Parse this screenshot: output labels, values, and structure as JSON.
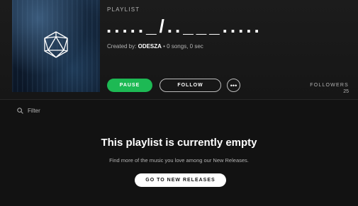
{
  "header": {
    "type_label": "PLAYLIST",
    "title": "....._/..___.....",
    "created_by_label": "Created by:",
    "owner": "ODESZA",
    "stats": " • 0 songs, 0 sec"
  },
  "cover": {
    "icon": "icosahedron-logo-icon"
  },
  "actions": {
    "pause_label": "PAUSE",
    "follow_label": "FOLLOW",
    "more_label": "•••"
  },
  "followers": {
    "label": "FOLLOWERS",
    "count": "25"
  },
  "filter": {
    "icon": "search-icon",
    "placeholder": "Filter"
  },
  "empty_state": {
    "title": "This playlist is currently empty",
    "subtitle": "Find more of the music you love among our New Releases.",
    "button_label": "GO TO NEW RELEASES"
  },
  "colors": {
    "accent": "#1db954",
    "background": "#121212",
    "text_secondary": "#b3b3b3"
  }
}
